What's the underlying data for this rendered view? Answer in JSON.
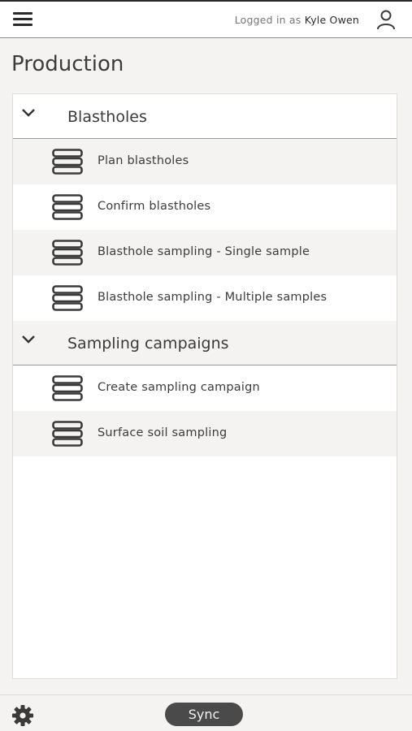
{
  "header": {
    "menu_icon": "hamburger-icon",
    "login_prefix": "Logged in as",
    "user_name": "Kyle Owen",
    "user_icon": "user-icon"
  },
  "page": {
    "title": "Production"
  },
  "groups": [
    {
      "label": "Blastholes",
      "icon": "chevron-down-icon",
      "items": [
        {
          "label": "Plan blastholes",
          "icon": "stack-icon"
        },
        {
          "label": "Confirm blastholes",
          "icon": "stack-icon"
        },
        {
          "label": "Blasthole sampling - Single sample",
          "icon": "stack-icon"
        },
        {
          "label": "Blasthole sampling - Multiple samples",
          "icon": "stack-icon"
        }
      ]
    },
    {
      "label": "Sampling campaigns",
      "icon": "chevron-down-icon",
      "items": [
        {
          "label": "Create sampling campaign",
          "icon": "stack-icon"
        },
        {
          "label": "Surface soil sampling",
          "icon": "stack-icon"
        }
      ]
    }
  ],
  "footer": {
    "settings_icon": "gear-icon",
    "sync_label": "Sync"
  },
  "colors": {
    "background": "#f4f3f1",
    "panel": "#ffffff",
    "sync_button": "#4a4a4a",
    "text": "#3a3a3a"
  }
}
